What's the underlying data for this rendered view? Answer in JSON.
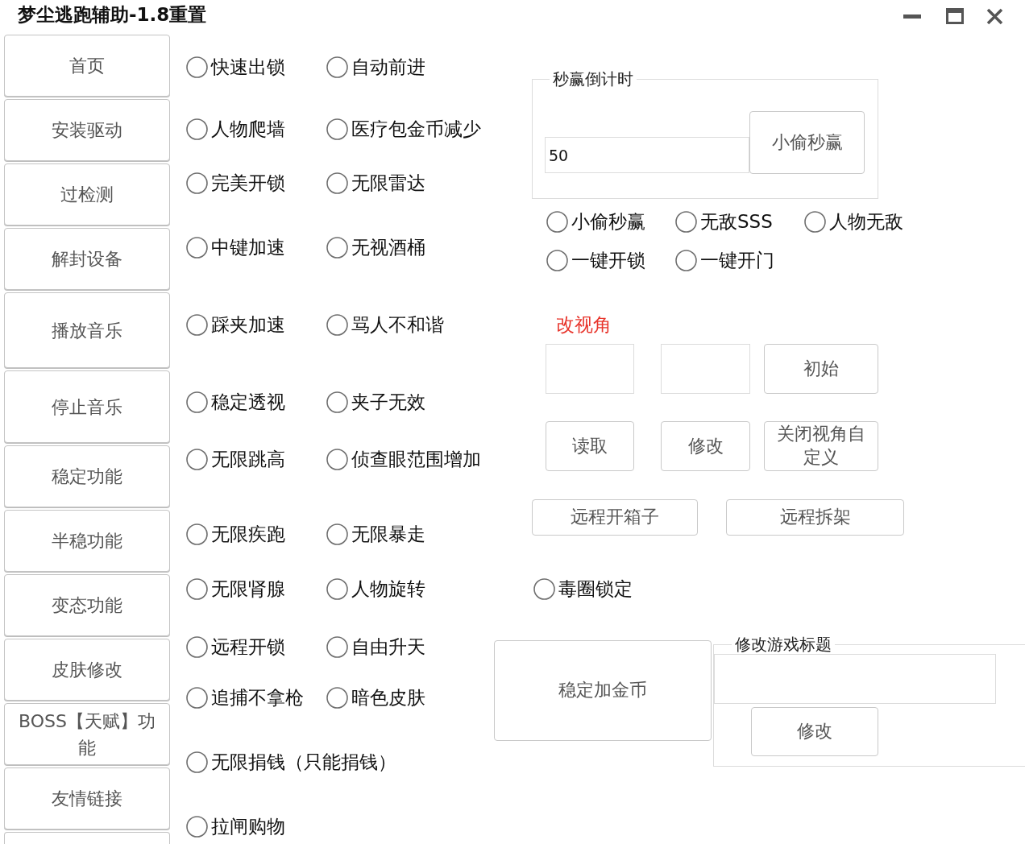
{
  "window": {
    "title": "梦尘逃跑辅助-1.8重置"
  },
  "sidebar": {
    "items": [
      {
        "label": "首页"
      },
      {
        "label": "安装驱动"
      },
      {
        "label": "过检测"
      },
      {
        "label": "解封设备"
      },
      {
        "label": "播放音乐"
      },
      {
        "label": "停止音乐"
      },
      {
        "label": "稳定功能"
      },
      {
        "label": "半稳功能"
      },
      {
        "label": "变态功能"
      },
      {
        "label": "皮肤修改"
      },
      {
        "label": "BOSS【天赋】功能"
      },
      {
        "label": "友情链接"
      }
    ]
  },
  "option_rows": [
    [
      {
        "label": "快速出锁",
        "selected": false
      },
      {
        "label": "自动前进",
        "selected": false
      }
    ],
    [
      {
        "label": "人物爬墙",
        "selected": false
      },
      {
        "label": "医疗包金币减少",
        "selected": false
      }
    ],
    [
      {
        "label": "完美开锁",
        "selected": false
      },
      {
        "label": "无限雷达",
        "selected": false
      }
    ],
    [
      {
        "label": "中键加速",
        "selected": false
      },
      {
        "label": "无视酒桶",
        "selected": false
      }
    ],
    [
      {
        "label": "踩夹加速",
        "selected": false
      },
      {
        "label": "骂人不和谐",
        "selected": false
      }
    ],
    [
      {
        "label": "稳定透视",
        "selected": false
      },
      {
        "label": "夹子无效",
        "selected": false
      }
    ],
    [
      {
        "label": "无限跳高",
        "selected": false
      },
      {
        "label": "侦查眼范围增加",
        "selected": false
      }
    ],
    [
      {
        "label": "无限疾跑",
        "selected": false
      },
      {
        "label": "无限暴走",
        "selected": false
      }
    ],
    [
      {
        "label": "无限肾腺",
        "selected": false
      },
      {
        "label": "人物旋转",
        "selected": false
      }
    ],
    [
      {
        "label": "远程开锁",
        "selected": false
      },
      {
        "label": "自由升天",
        "selected": false
      }
    ],
    [
      {
        "label": "追捕不拿枪",
        "selected": false
      },
      {
        "label": "暗色皮肤",
        "selected": false
      }
    ],
    [
      {
        "label": "无限捐钱（只能捐钱）",
        "selected": false
      }
    ],
    [
      {
        "label": "拉闸购物",
        "selected": false
      }
    ]
  ],
  "countdown_group": {
    "legend": "秒赢倒计时",
    "input": {
      "value": "50"
    },
    "button": "小偷秒赢"
  },
  "countdown_options": [
    [
      {
        "label": "小偷秒赢",
        "selected": false
      },
      {
        "label": "无敌SSS",
        "selected": false
      },
      {
        "label": "人物无敌",
        "selected": false
      }
    ],
    [
      {
        "label": "一键开锁",
        "selected": false
      },
      {
        "label": "一键开门",
        "selected": false
      }
    ]
  ],
  "view_angle": {
    "label": "改视角",
    "top_button": "初始",
    "buttons": [
      "读取",
      "修改",
      "关闭视角自定义"
    ]
  },
  "remote_buttons": [
    "远程开箱子",
    "远程拆架"
  ],
  "poison_lock": {
    "label": "毒圈锁定",
    "selected": false
  },
  "coin_button": "稳定加金币",
  "title_group": {
    "legend": "修改游戏标题",
    "button": "修改"
  }
}
